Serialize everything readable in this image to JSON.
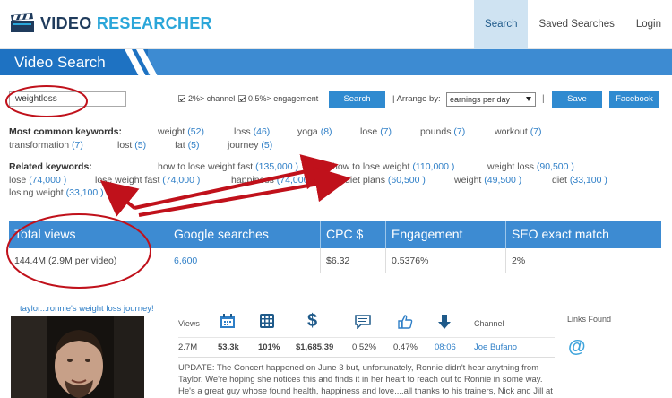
{
  "brand": {
    "part1": "VIDEO ",
    "part2": "RESEARCHER"
  },
  "nav": [
    {
      "label": "Search"
    },
    {
      "label": "Saved Searches"
    },
    {
      "label": "Login"
    }
  ],
  "page_title": "Video Search",
  "search": {
    "value": "weightloss",
    "filter1": "2%> channel",
    "filter2": "0.5%> engagement",
    "search_button": "Search",
    "arrange_label": "| Arrange by:",
    "arrange_value": "earnings per day",
    "save_button": "Save",
    "facebook_button": "Facebook",
    "separator": "|"
  },
  "common": {
    "label": "Most common keywords:",
    "items": [
      {
        "word": "weight",
        "count": "(52)"
      },
      {
        "word": "loss",
        "count": "(46)"
      },
      {
        "word": "yoga",
        "count": "(8)"
      },
      {
        "word": "lose",
        "count": "(7)"
      },
      {
        "word": "pounds",
        "count": "(7)"
      },
      {
        "word": "workout",
        "count": "(7)"
      },
      {
        "word": "transformation",
        "count": "(7)"
      },
      {
        "word": "lost",
        "count": "(5)"
      },
      {
        "word": "fat",
        "count": "(5)"
      },
      {
        "word": "journey",
        "count": "(5)"
      }
    ]
  },
  "related": {
    "label": "Related keywords:",
    "items": [
      {
        "word": "how to lose weight fast",
        "count": "(135,000 )"
      },
      {
        "word": "how to lose weight",
        "count": "(110,000 )"
      },
      {
        "word": "weight loss",
        "count": "(90,500 )"
      },
      {
        "word": "lose",
        "count": "(74,000 )"
      },
      {
        "word": "lose weight fast",
        "count": "(74,000 )"
      },
      {
        "word": "happiness",
        "count": "(74,000 )"
      },
      {
        "word": "diet plans",
        "count": "(60,500 )"
      },
      {
        "word": "weight",
        "count": "(49,500 )"
      },
      {
        "word": "diet",
        "count": "(33,100 )"
      },
      {
        "word": "losing weight",
        "count": "(33,100 )"
      }
    ]
  },
  "summary": {
    "headers": [
      "Total views",
      "Google searches",
      "CPC $",
      "Engagement",
      "SEO exact match"
    ],
    "values": [
      "144.4M (2.9M per video)",
      "6,600",
      "$6.32",
      "0.5376%",
      "2%"
    ]
  },
  "video": {
    "title": "taylor...ronnie's weight loss journey!",
    "views_label": "Views",
    "channel_label": "Channel",
    "links_label": "Links Found",
    "views": "2.7M",
    "s1": "53.3k",
    "s2": "101%",
    "s3": "$1,685.39",
    "s4": "0.52%",
    "s5": "0.47%",
    "s6": "08:06",
    "channel": "Joe Bufano",
    "description": "UPDATE: The Concert happened on June 3 but, unfortunately, Ronnie didn't hear anything from Taylor. We're hoping she notices this and finds it in her heart to reach out to Ronnie in some way. He's a great guy whose found health, happiness and love....all thanks to his trainers, Nick and Jill at"
  },
  "icons": {
    "logo": "clapperboard-icon",
    "calendar": "calendar-icon",
    "grid": "calculator-grid-icon",
    "dollar": "dollar-icon",
    "comment": "comment-icon",
    "like": "thumbs-up-icon",
    "down": "down-arrow-icon",
    "at": "at-sign-icon"
  },
  "colors": {
    "primary": "#3d8bd2",
    "accent_link": "#2f7fc7",
    "annotation": "#c0111b"
  }
}
